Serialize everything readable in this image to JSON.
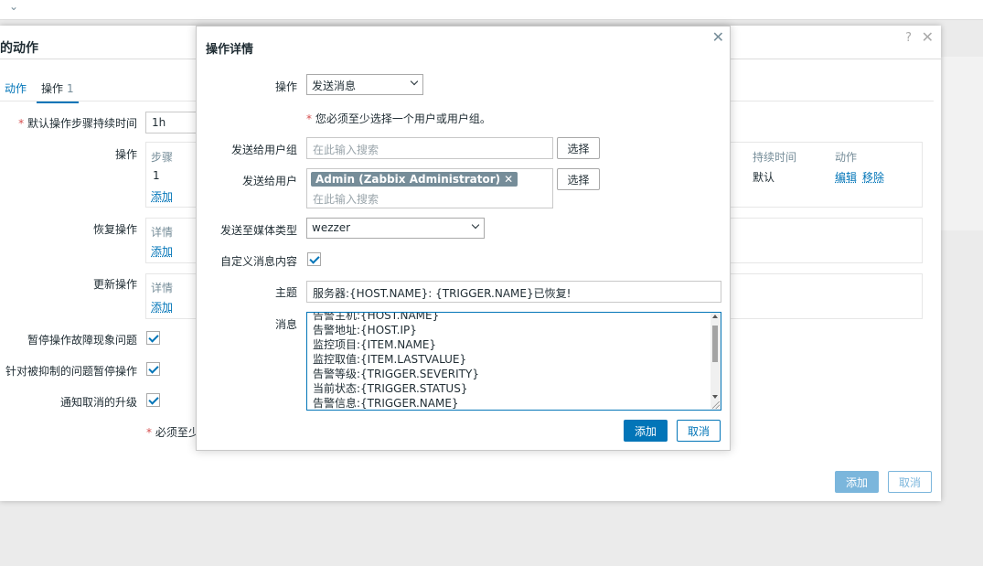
{
  "background_page": {
    "dialog_title": "新的动作",
    "help_icon": "?",
    "tabs": [
      {
        "label": "动作"
      },
      {
        "label": "操作",
        "count": "1"
      }
    ],
    "default_step_duration_label": "默认操作步骤持续时间",
    "default_step_duration_value": "1h",
    "operations_label": "操作",
    "operations_columns": {
      "step": "步骤",
      "duration": "持续时间",
      "action": "动作"
    },
    "operations_row": {
      "step": "1",
      "duration": "默认",
      "edit": "编辑",
      "remove": "移除"
    },
    "add_link": "添加",
    "recovery_label": "恢复操作",
    "update_label": "更新操作",
    "details_col": "详情",
    "pause_problems_label": "暂停操作故障现象问题",
    "pause_suppressed_label": "针对被抑制的问题暂停操作",
    "notify_cancel_label": "通知取消的升级",
    "required_note": "必须至少",
    "add_button": "添加",
    "cancel_button": "取消"
  },
  "modal": {
    "title": "操作详情",
    "operation_label": "操作",
    "operation_value": "发送消息",
    "required_note": "您必须至少选择一个用户或用户组。",
    "send_to_groups_label": "发送给用户组",
    "send_to_groups_placeholder": "在此输入搜索",
    "select_button": "选择",
    "send_to_users_label": "发送给用户",
    "user_tag": "Admin (Zabbix Administrator)",
    "send_to_users_placeholder": "在此输入搜索",
    "media_type_label": "发送至媒体类型",
    "media_type_value": "wezzer",
    "custom_message_label": "自定义消息内容",
    "custom_message_checked": true,
    "subject_label": "主题",
    "subject_value": "服务器:{HOST.NAME}: {TRIGGER.NAME}已恢复!",
    "message_label": "消息",
    "message_lines": [
      "告警主机:{HOST.NAME}",
      "告警地址:{HOST.IP}",
      "监控项目:{ITEM.NAME}",
      "监控取值:{ITEM.LASTVALUE}",
      "告警等级:{TRIGGER.SEVERITY}",
      "当前状态:{TRIGGER.STATUS}",
      "告警信息:{TRIGGER.NAME}"
    ],
    "add_button": "添加",
    "cancel_button": "取消"
  },
  "colors": {
    "accent": "#0275b8",
    "required": "#d64e4e",
    "muted": "#768d99"
  }
}
